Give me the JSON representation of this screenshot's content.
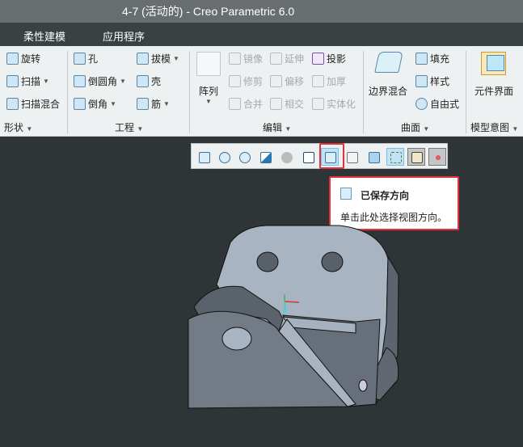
{
  "title": "4-7 (活动的) - Creo Parametric 6.0",
  "menu": [
    "柔性建模",
    "应用程序"
  ],
  "ribbon": {
    "shape": {
      "items": [
        "旋转",
        "扫描",
        "扫描混合"
      ],
      "group": "形状"
    },
    "engineering": {
      "items": [
        "孔",
        "倒圆角",
        "倒角",
        "拔模",
        "壳",
        "筋"
      ],
      "group": "工程"
    },
    "edit": {
      "pattern": "阵列",
      "items": [
        "镜像",
        "修剪",
        "合并",
        "延伸",
        "偏移",
        "相交",
        "投影",
        "加厚",
        "实体化"
      ],
      "group": "编辑"
    },
    "surface": {
      "boundary": "边界混合",
      "items": [
        "填充",
        "样式",
        "自由式"
      ],
      "group": "曲面"
    },
    "intent": {
      "item": "元件界面",
      "group": "模型意图"
    }
  },
  "view_toolbar": [
    "refit-icon",
    "zoom-in-icon",
    "zoom-out-icon",
    "repaint-icon",
    "display-style-icon",
    "view-orientation-icon",
    "saved-orientations-icon",
    "view-manager-icon",
    "perspective-icon",
    "datum-display-icon",
    "annotation-display-icon",
    "spin-center-icon"
  ],
  "tooltip": {
    "title": "已保存方向",
    "desc": "单击此处选择视图方向。"
  },
  "colors": {
    "accent": "#e5323a",
    "background": "#2f3437"
  }
}
